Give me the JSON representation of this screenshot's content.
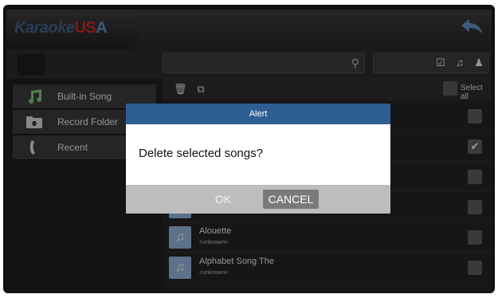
{
  "app": {
    "logo_part1": "Karaoke",
    "logo_part2": "US",
    "logo_part3": "A"
  },
  "sidebar": {
    "items": [
      {
        "label": "Built-in Song",
        "icon": "music-note-icon"
      },
      {
        "label": "Record Folder",
        "icon": "folder-icon"
      },
      {
        "label": "Recent",
        "icon": "recent-icon"
      }
    ]
  },
  "list": {
    "select_all_label": "Select all",
    "rows": [
      {
        "title": "",
        "artist": "<unknown>",
        "checked": false
      },
      {
        "title": "Alouette",
        "artist": "<unknown>",
        "checked": false
      },
      {
        "title": "Alphabet Song The",
        "artist": "<unknown>",
        "checked": false
      }
    ],
    "checked_mark": "✔"
  },
  "dialog": {
    "title": "Alert",
    "message": "Delete selected songs?",
    "ok_label": "OK",
    "cancel_label": "CANCEL"
  }
}
